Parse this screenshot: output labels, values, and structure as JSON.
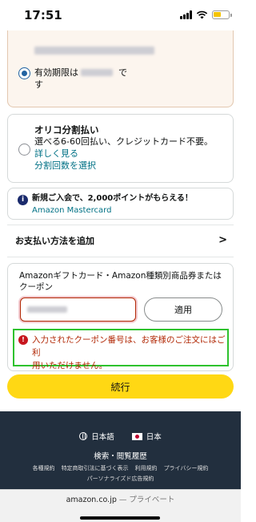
{
  "status": {
    "time": "17:51"
  },
  "selected_card": {
    "expiry_prefix": "有効期限は",
    "expiry_suffix_1": "で",
    "expiry_suffix_2": "す"
  },
  "orico": {
    "title": "オリコ分割払い",
    "description": "選べる6-60回払い、クレジットカード不要。",
    "learn_more": "詳しく見る",
    "select_installments": "分割回数を選択"
  },
  "promo": {
    "text": "新規ご入会で、2,000ポイントがもらえる！",
    "card_name": "Amazon Mastercard"
  },
  "add_payment": {
    "label": "お支払い方法を追加",
    "chevron": ">"
  },
  "coupon": {
    "title_line1": "Amazonギフトカード・Amazon種類別商品券または",
    "title_line2": "クーポン",
    "apply_label": "適用",
    "error_icon": "!",
    "error_line1": "入力されたクーポン番号は、お客様のご注文にはご利",
    "error_line2": "用いただけません。"
  },
  "continue_label": "続行",
  "footer": {
    "language": "日本語",
    "country": "日本",
    "search_history": "検索・閲覧履歴",
    "links": [
      "各種規約",
      "特定商取引法に基づく表示",
      "利用規約",
      "プライバシー規約"
    ],
    "personalized_ads": "パーソナライズド広告規約"
  },
  "browser": {
    "domain": "amazon.co.jp",
    "mode": " — プライベート"
  },
  "colors": {
    "accent": "#ffd814",
    "link": "#007185",
    "error": "#b12704",
    "footer_bg": "#222f3e"
  }
}
